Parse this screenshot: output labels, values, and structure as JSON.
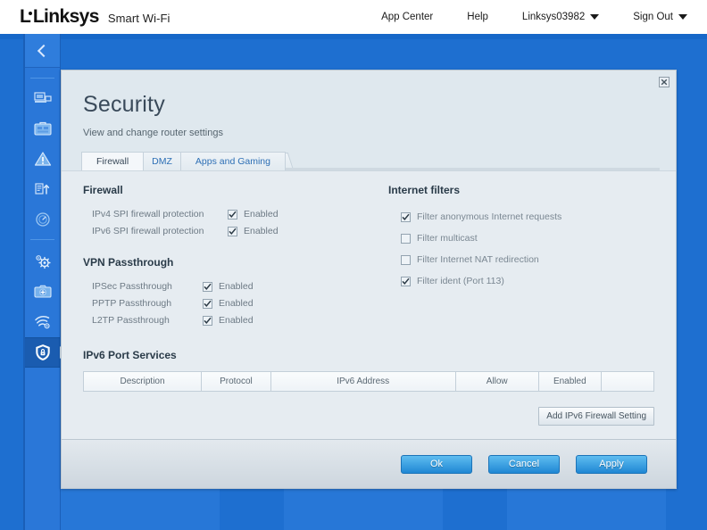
{
  "brand": {
    "logo_text": "Linksys",
    "product": "Smart Wi-Fi"
  },
  "topnav": {
    "items": [
      {
        "label": "App Center",
        "icon": "",
        "has_caret": false
      },
      {
        "label": "Help",
        "icon": "",
        "has_caret": false
      },
      {
        "label": "Linksys03982",
        "icon": "chevron-down-icon",
        "has_caret": true
      },
      {
        "label": "Sign Out",
        "icon": "chevron-down-icon",
        "has_caret": true
      }
    ]
  },
  "sidebar": {
    "back_icon": "chevron-left-icon",
    "items": [
      {
        "name": "network-map",
        "icon": "network-map-icon",
        "active": false
      },
      {
        "name": "device-list",
        "icon": "device-briefcase-icon",
        "active": false
      },
      {
        "name": "parental-controls",
        "icon": "warning-triangle-icon",
        "active": false
      },
      {
        "name": "media-prioritization",
        "icon": "priority-arrows-icon",
        "active": false
      },
      {
        "name": "speed-test",
        "icon": "speed-gauge-icon",
        "active": false
      },
      {
        "name": "connectivity",
        "icon": "gears-icon",
        "active": false
      },
      {
        "name": "troubleshooting",
        "icon": "camera-plus-icon",
        "active": false
      },
      {
        "name": "wireless",
        "icon": "wifi-icon",
        "active": false
      },
      {
        "name": "security",
        "icon": "shield-lock-icon",
        "active": true
      }
    ]
  },
  "panel": {
    "title": "Security",
    "subtitle": "View and change router settings",
    "close_icon": "close-icon",
    "tabs": [
      {
        "label": "Firewall",
        "active": true
      },
      {
        "label": "DMZ",
        "active": false
      },
      {
        "label": "Apps and Gaming",
        "active": false
      }
    ],
    "firewall": {
      "heading": "Firewall",
      "rows": [
        {
          "label": "IPv4 SPI firewall protection",
          "checkbox_label": "Enabled",
          "checked": true
        },
        {
          "label": "IPv6 SPI firewall protection",
          "checkbox_label": "Enabled",
          "checked": true
        }
      ]
    },
    "vpn_passthrough": {
      "heading": "VPN Passthrough",
      "rows": [
        {
          "label": "IPSec Passthrough",
          "checkbox_label": "Enabled",
          "checked": true
        },
        {
          "label": "PPTP Passthrough",
          "checkbox_label": "Enabled",
          "checked": true
        },
        {
          "label": "L2TP Passthrough",
          "checkbox_label": "Enabled",
          "checked": true
        }
      ]
    },
    "internet_filters": {
      "heading": "Internet filters",
      "rows": [
        {
          "label": "Filter anonymous Internet requests",
          "checked": true
        },
        {
          "label": "Filter multicast",
          "checked": false
        },
        {
          "label": "Filter Internet NAT redirection",
          "checked": false
        },
        {
          "label": "Filter ident (Port 113)",
          "checked": true
        }
      ]
    },
    "ipv6_port_services": {
      "heading": "IPv6 Port Services",
      "columns": [
        "Description",
        "Protocol",
        "IPv6 Address",
        "Allow",
        "Enabled",
        ""
      ],
      "rows": [],
      "add_button": "Add IPv6 Firewall Setting"
    },
    "footer": {
      "ok": "Ok",
      "cancel": "Cancel",
      "apply": "Apply"
    }
  },
  "colors": {
    "brand_blue": "#1e6fd0",
    "sidebar_blue": "#2a77d8",
    "active_item": "#1a5cb0",
    "panel_bg": "#e6ecf1",
    "button_blue": "#1f87d4",
    "tab_link": "#2d6fb5"
  }
}
